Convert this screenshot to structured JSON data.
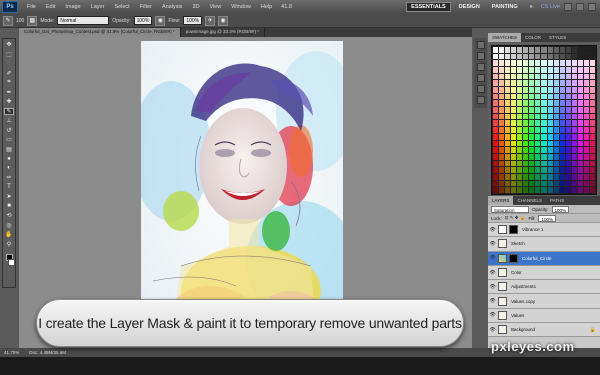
{
  "menubar": {
    "app_icon": "Ps",
    "items": [
      "File",
      "Edit",
      "Image",
      "Layer",
      "Select",
      "Filter",
      "Analysis",
      "3D",
      "View",
      "Window",
      "Help"
    ],
    "zoom": "41.8",
    "workspaces": [
      "ESSENTIALS",
      "DESIGN",
      "PAINTING"
    ],
    "more": "»",
    "cslive": "CS Live"
  },
  "options": {
    "brush_size": "100",
    "mode_label": "Mode:",
    "mode_value": "Normal",
    "opacity_label": "Opacity:",
    "opacity_value": "100%",
    "flow_label": "Flow:",
    "flow_value": "100%"
  },
  "tabs": [
    {
      "label": "Colorful_Girl_Photoshop_Contest.psd @ 41.8% (Colorful_Circle, RGB/8#) *"
    },
    {
      "label": "pownimage.jpg @ 33.3% (RGB/8#) *"
    }
  ],
  "tools": [
    "move-icon",
    "marquee-icon",
    "lasso-icon",
    "quick-select-icon",
    "crop-icon",
    "eyedropper-icon",
    "healing-icon",
    "brush-icon",
    "stamp-icon",
    "history-brush-icon",
    "eraser-icon",
    "gradient-icon",
    "blur-icon",
    "dodge-icon",
    "pen-icon",
    "type-icon",
    "path-select-icon",
    "shape-icon",
    "3d-rotate-icon",
    "3d-orbit-icon",
    "hand-icon",
    "zoom-icon"
  ],
  "swatches_panel": {
    "tabs": [
      "SWATCHES",
      "COLOR",
      "STYLES"
    ]
  },
  "layers_panel": {
    "tabs": [
      "LAYERS",
      "CHANNELS",
      "PATHS"
    ],
    "blend_mode": "Saturation",
    "opacity_label": "Opacity:",
    "opacity_value": "100%",
    "lock_label": "Lock:",
    "fill_label": "Fill:",
    "fill_value": "100%",
    "layers": [
      {
        "name": "Vibrance 1",
        "type": "adjustment",
        "selected": false
      },
      {
        "name": "Sketch",
        "type": "image",
        "selected": false
      },
      {
        "name": "Colorful_Circle",
        "type": "mask",
        "selected": true
      },
      {
        "name": "Color",
        "type": "color",
        "selected": false
      },
      {
        "name": "Adjustments",
        "type": "image",
        "selected": false
      },
      {
        "name": "Values copy",
        "type": "image",
        "selected": false
      },
      {
        "name": "Values",
        "type": "image",
        "selected": false
      },
      {
        "name": "Background",
        "type": "image",
        "selected": false
      }
    ]
  },
  "status": {
    "zoom": "41.75%",
    "doc": "Doc: 4.48M/35.6M"
  },
  "caption": "I create the Layer Mask & paint it to temporary remove unwanted parts",
  "watermark": "pxleyes.com"
}
